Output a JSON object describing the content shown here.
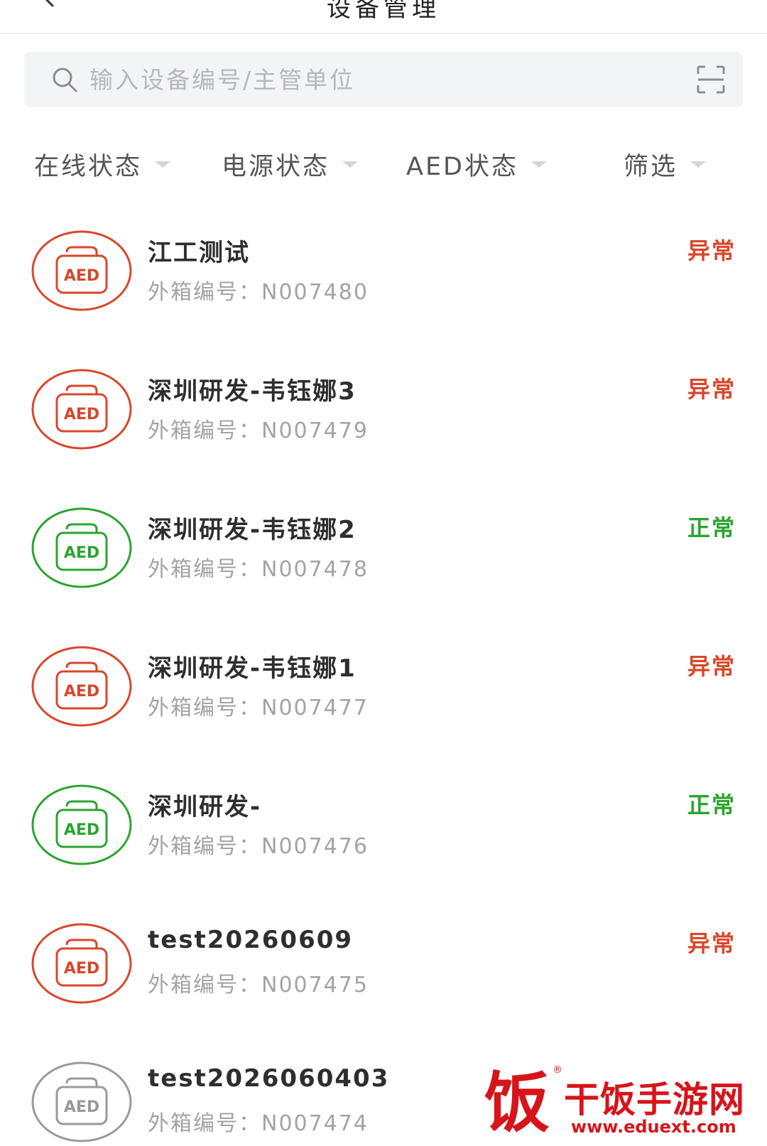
{
  "header": {
    "title": "设备管理",
    "back_icon": "chevron-left-icon"
  },
  "search": {
    "placeholder": "输入设备编号/主管单位",
    "value": "",
    "icon": "search-icon",
    "scan_icon": "scan-icon"
  },
  "filters": [
    {
      "label": "在线状态"
    },
    {
      "label": "电源状态"
    },
    {
      "label": "AED状态"
    },
    {
      "label": "筛选"
    }
  ],
  "devices": [
    {
      "name": "江工测试",
      "code_label": "外箱编号：",
      "code": "N007480",
      "status": "异常",
      "status_type": "error"
    },
    {
      "name": "深圳研发-韦钰娜3",
      "code_label": "外箱编号：",
      "code": "N007479",
      "status": "异常",
      "status_type": "error"
    },
    {
      "name": "深圳研发-韦钰娜2",
      "code_label": "外箱编号：",
      "code": "N007478",
      "status": "正常",
      "status_type": "normal"
    },
    {
      "name": "深圳研发-韦钰娜1",
      "code_label": "外箱编号：",
      "code": "N007477",
      "status": "异常",
      "status_type": "error"
    },
    {
      "name": "深圳研发-",
      "code_label": "外箱编号：",
      "code": "N007476",
      "status": "正常",
      "status_type": "normal"
    },
    {
      "name": "test20260609",
      "code_label": "外箱编号：",
      "code": "N007475",
      "status": "异常",
      "status_type": "error"
    },
    {
      "name": "test2026060403",
      "code_label": "外箱编号：",
      "code": "N007474",
      "status": "",
      "status_type": "offline"
    }
  ],
  "aed_icon_label": "AED",
  "status_colors": {
    "error": "#d9472b",
    "normal": "#2aa52f",
    "offline": "#9a9a9a"
  },
  "watermark": {
    "glyph": "饭",
    "name": "干饭手游网",
    "url": "www.eduext.com"
  }
}
